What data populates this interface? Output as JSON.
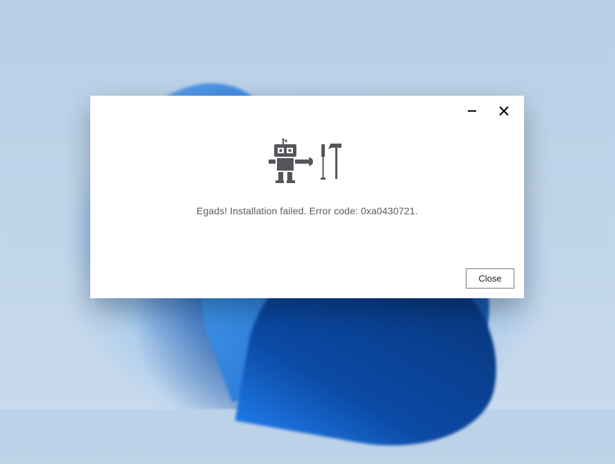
{
  "error": {
    "message": "Egads! Installation failed. Error code: 0xa0430721."
  },
  "dialog": {
    "close_button_label": "Close"
  },
  "icons": {
    "minimize": "minimize-icon",
    "close": "close-icon",
    "robot_tools": "robot-tools-icon"
  }
}
